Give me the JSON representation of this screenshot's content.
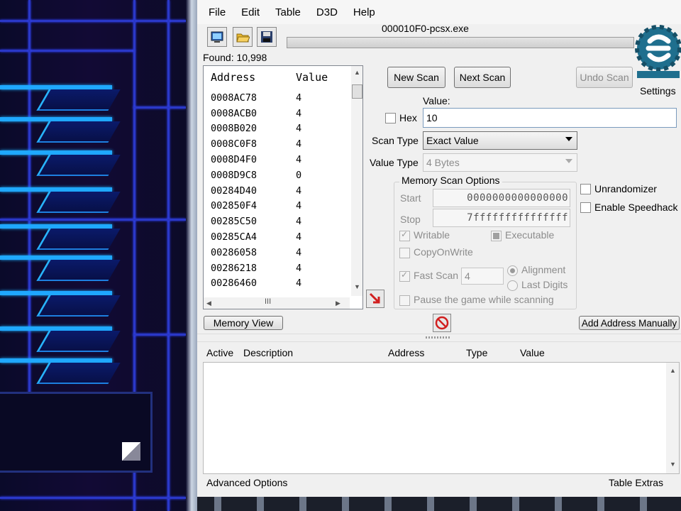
{
  "window": {
    "process_title": "000010F0-pcsx.exe",
    "found_label": "Found: 10,998"
  },
  "menu": [
    "File",
    "Edit",
    "Table",
    "D3D",
    "Help"
  ],
  "toolbar_icons": [
    "process-select-icon",
    "open-folder-icon",
    "save-disk-icon"
  ],
  "address_list": {
    "columns": {
      "address": "Address",
      "value": "Value"
    },
    "rows": [
      {
        "address": "0008AC78",
        "value": "4"
      },
      {
        "address": "0008ACB0",
        "value": "4"
      },
      {
        "address": "0008B020",
        "value": "4"
      },
      {
        "address": "0008C0F8",
        "value": "4"
      },
      {
        "address": "0008D4F0",
        "value": "4"
      },
      {
        "address": "0008D9C8",
        "value": "0"
      },
      {
        "address": "00284D40",
        "value": "4"
      },
      {
        "address": "002850F4",
        "value": "4"
      },
      {
        "address": "00285C50",
        "value": "4"
      },
      {
        "address": "00285CA4",
        "value": "4"
      },
      {
        "address": "00286058",
        "value": "4"
      },
      {
        "address": "00286218",
        "value": "4"
      },
      {
        "address": "00286460",
        "value": "4"
      }
    ],
    "hscroll_glyph": "III"
  },
  "scan": {
    "new_scan": "New Scan",
    "next_scan": "Next Scan",
    "undo_scan": "Undo Scan",
    "settings": "Settings",
    "value_label": "Value:",
    "hex_label": "Hex",
    "value": "10",
    "scan_type_label": "Scan Type",
    "scan_type_value": "Exact Value",
    "value_type_label": "Value Type",
    "value_type_value": "4 Bytes"
  },
  "memory_options": {
    "title": "Memory Scan Options",
    "start_label": "Start",
    "start_value": "0000000000000000",
    "stop_label": "Stop",
    "stop_value": "7fffffffffffffff",
    "writable": "Writable",
    "executable": "Executable",
    "copyonwrite": "CopyOnWrite",
    "fast_scan": "Fast Scan",
    "fast_scan_value": "4",
    "alignment": "Alignment",
    "last_digits": "Last Digits",
    "pause": "Pause the game while scanning"
  },
  "side_options": {
    "unrandomizer": "Unrandomizer",
    "speedhack": "Enable Speedhack"
  },
  "buttons": {
    "memory_view": "Memory View",
    "add_address": "Add Address Manually"
  },
  "cheat_table": {
    "columns": [
      "Active",
      "Description",
      "Address",
      "Type",
      "Value"
    ]
  },
  "footer": {
    "advanced": "Advanced Options",
    "extras": "Table Extras"
  },
  "colors": {
    "logo": "#1f6f8e",
    "accent_red": "#d11f1f"
  }
}
